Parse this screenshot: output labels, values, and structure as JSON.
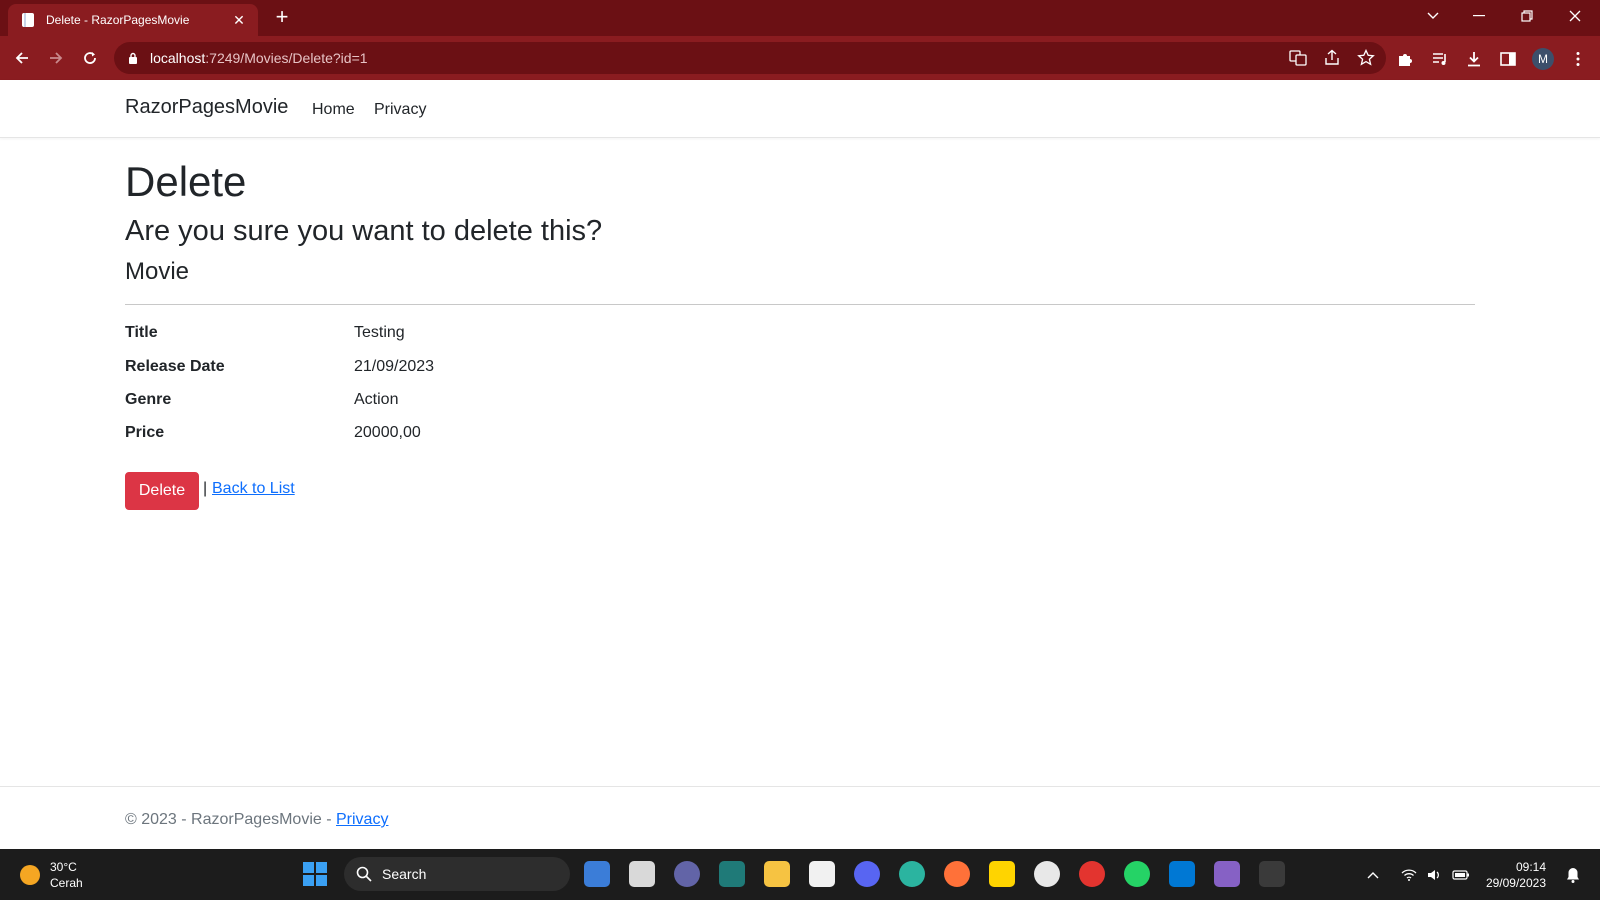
{
  "browser": {
    "tab_title": "Delete - RazorPagesMovie",
    "tab_close": "✕",
    "new_tab": "+",
    "url_host": "localhost",
    "url_rest": ":7249/Movies/Delete?id=1",
    "profile_initial": "M"
  },
  "nav": {
    "brand": "RazorPagesMovie",
    "links": [
      "Home",
      "Privacy"
    ]
  },
  "page": {
    "heading": "Delete",
    "confirm": "Are you sure you want to delete this?",
    "subheading": "Movie",
    "fields": [
      {
        "label": "Title",
        "value": "Testing"
      },
      {
        "label": "Release Date",
        "value": "21/09/2023"
      },
      {
        "label": "Genre",
        "value": "Action"
      },
      {
        "label": "Price",
        "value": "20000,00"
      }
    ],
    "delete_label": "Delete",
    "separator": "|",
    "back_label": "Back to List"
  },
  "footer": {
    "text": "© 2023 - RazorPagesMovie - ",
    "link": "Privacy"
  },
  "taskbar": {
    "temperature": "30°C",
    "condition": "Cerah",
    "search_label": "Search",
    "time": "09:14",
    "date": "29/09/2023"
  },
  "colors": {
    "tabstrip": "#6b1014",
    "toolbar": "#8a1c20",
    "danger": "#dc3545",
    "link": "#0d6efd",
    "taskbar": "#1c1c1c"
  }
}
